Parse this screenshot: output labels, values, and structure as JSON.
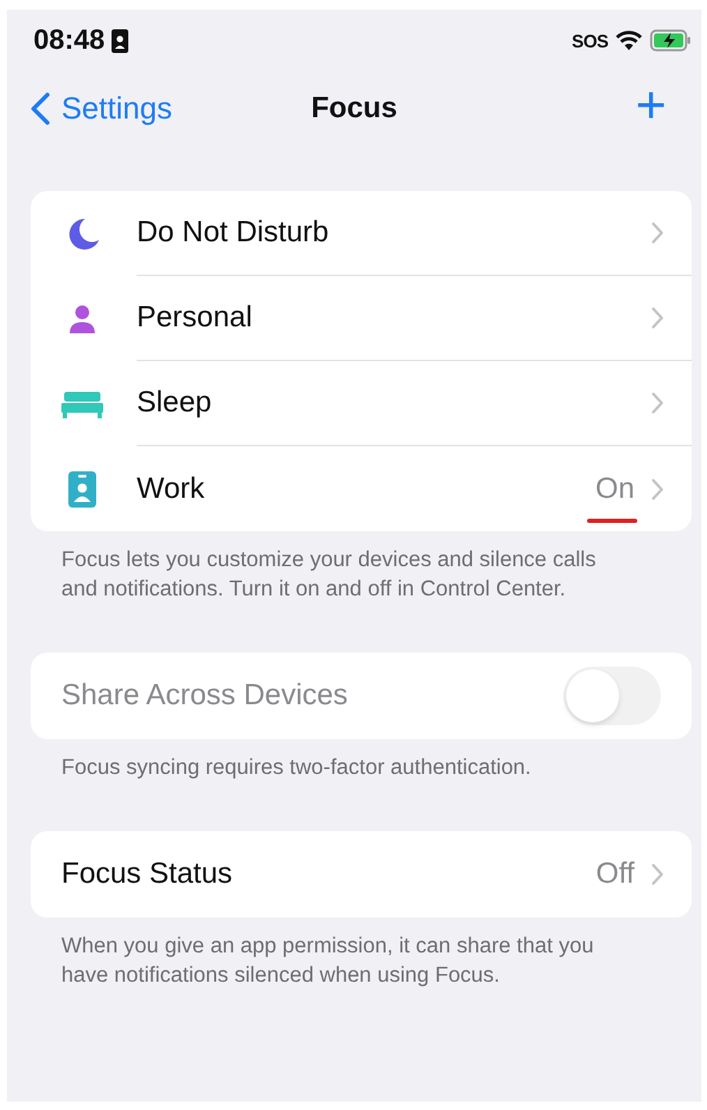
{
  "status_bar": {
    "time": "08:48",
    "carrier": "SOS"
  },
  "nav": {
    "back": "Settings",
    "title": "Focus",
    "add": "+"
  },
  "focus_modes": [
    {
      "kind": "moon",
      "label": "Do Not Disturb",
      "color": "#5e5ce6"
    },
    {
      "kind": "person",
      "label": "Personal",
      "color": "#af52de"
    },
    {
      "kind": "bed",
      "label": "Sleep",
      "color": "#30c8b8"
    },
    {
      "kind": "badge",
      "label": "Work",
      "color": "#30b0c7",
      "status": "On",
      "underlined": true
    }
  ],
  "focus_footer": "Focus lets you customize your devices and silence calls and notifications. Turn it on and off in Control Center.",
  "share": {
    "label": "Share Across Devices",
    "disabled": true,
    "on": false
  },
  "share_footer": "Focus syncing requires two-factor authentication.",
  "status": {
    "label": "Focus Status",
    "value": "Off"
  },
  "status_footer": "When you give an app permission, it can share that you have notifications silenced when using Focus."
}
